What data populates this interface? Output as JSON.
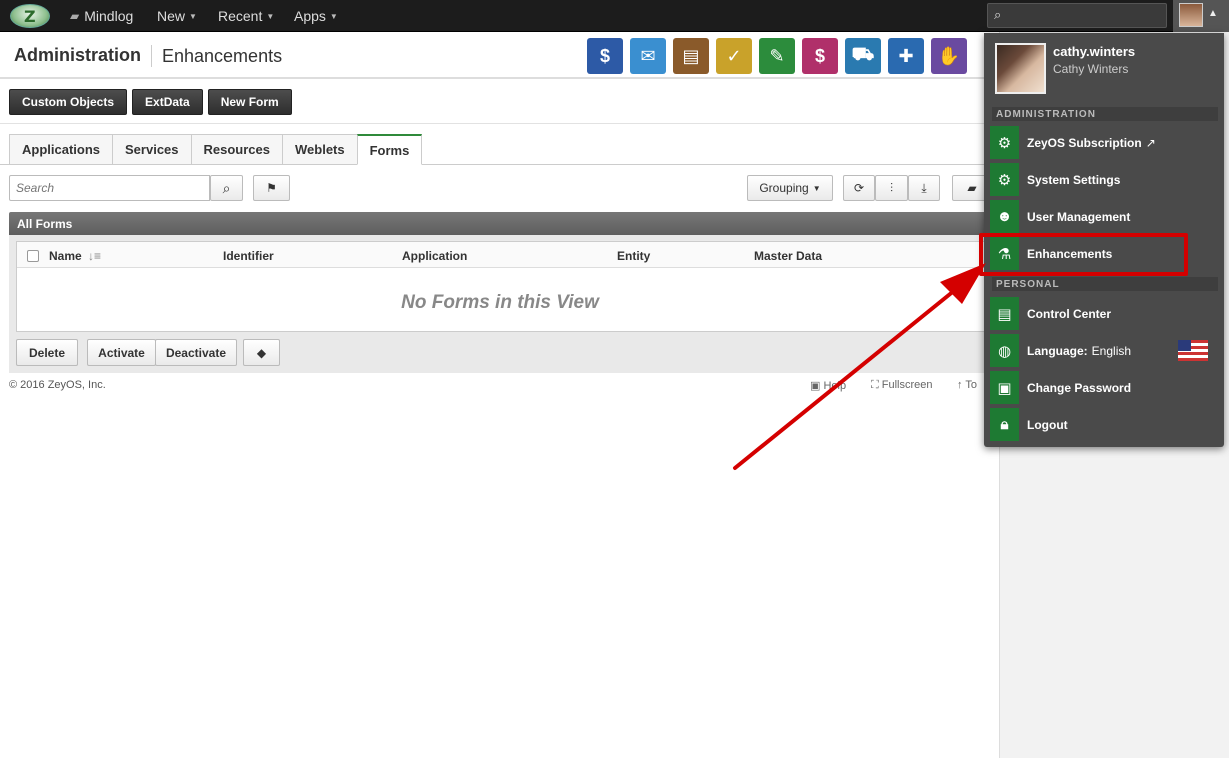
{
  "topbar": {
    "mindlog": "Mindlog",
    "new": "New",
    "recent": "Recent",
    "apps": "Apps",
    "search_placeholder": ""
  },
  "header": {
    "title": "Administration",
    "subtitle": "Enhancements",
    "app_icons": [
      {
        "icon": "dollar-icon",
        "color": "#2d5aa6",
        "glyph": "$"
      },
      {
        "icon": "mail-icon",
        "color": "#3a8fd0",
        "glyph": "✉"
      },
      {
        "icon": "contacts-icon",
        "color": "#8a5a2a",
        "glyph": "▤"
      },
      {
        "icon": "tasks-icon",
        "color": "#c9a22a",
        "glyph": "✓"
      },
      {
        "icon": "notes-icon",
        "color": "#2c8c3c",
        "glyph": "✎"
      },
      {
        "icon": "billing-icon",
        "color": "#b0306a",
        "glyph": "$"
      },
      {
        "icon": "truck-icon",
        "color": "#2a7ab0",
        "glyph": "⛟"
      },
      {
        "icon": "support-icon",
        "color": "#2a6ab0",
        "glyph": "✚"
      },
      {
        "icon": "handshake-icon",
        "color": "#6a4aa0",
        "glyph": "✋"
      }
    ]
  },
  "actions": {
    "custom_objects": "Custom Objects",
    "extdata": "ExtData",
    "new_form": "New Form"
  },
  "tabs": [
    "Applications",
    "Services",
    "Resources",
    "Weblets",
    "Forms"
  ],
  "toolbar": {
    "search_placeholder": "Search",
    "grouping": "Grouping"
  },
  "list": {
    "title": "All Forms",
    "columns": [
      "Name",
      "Identifier",
      "Application",
      "Entity",
      "Master Data"
    ],
    "empty": "No Forms in this View",
    "buttons": {
      "delete": "Delete",
      "activate": "Activate",
      "deactivate": "Deactivate"
    }
  },
  "footer": {
    "copyright": "© 2016 ZeyOS, Inc.",
    "help": "Help",
    "fullscreen": "Fullscreen",
    "top": "To"
  },
  "dropdown": {
    "username": "cathy.winters",
    "fullname": "Cathy Winters",
    "section_admin": "ADMINISTRATION",
    "section_personal": "PERSONAL",
    "items": {
      "subscription": "ZeyOS Subscription",
      "system_settings": "System Settings",
      "user_management": "User Management",
      "enhancements": "Enhancements",
      "control_center": "Control Center",
      "language_label": "Language:",
      "language_value": "English",
      "change_password": "Change Password",
      "logout": "Logout"
    }
  },
  "colors": {
    "accent_green": "#1e7a33",
    "highlight_red": "#d40000"
  }
}
